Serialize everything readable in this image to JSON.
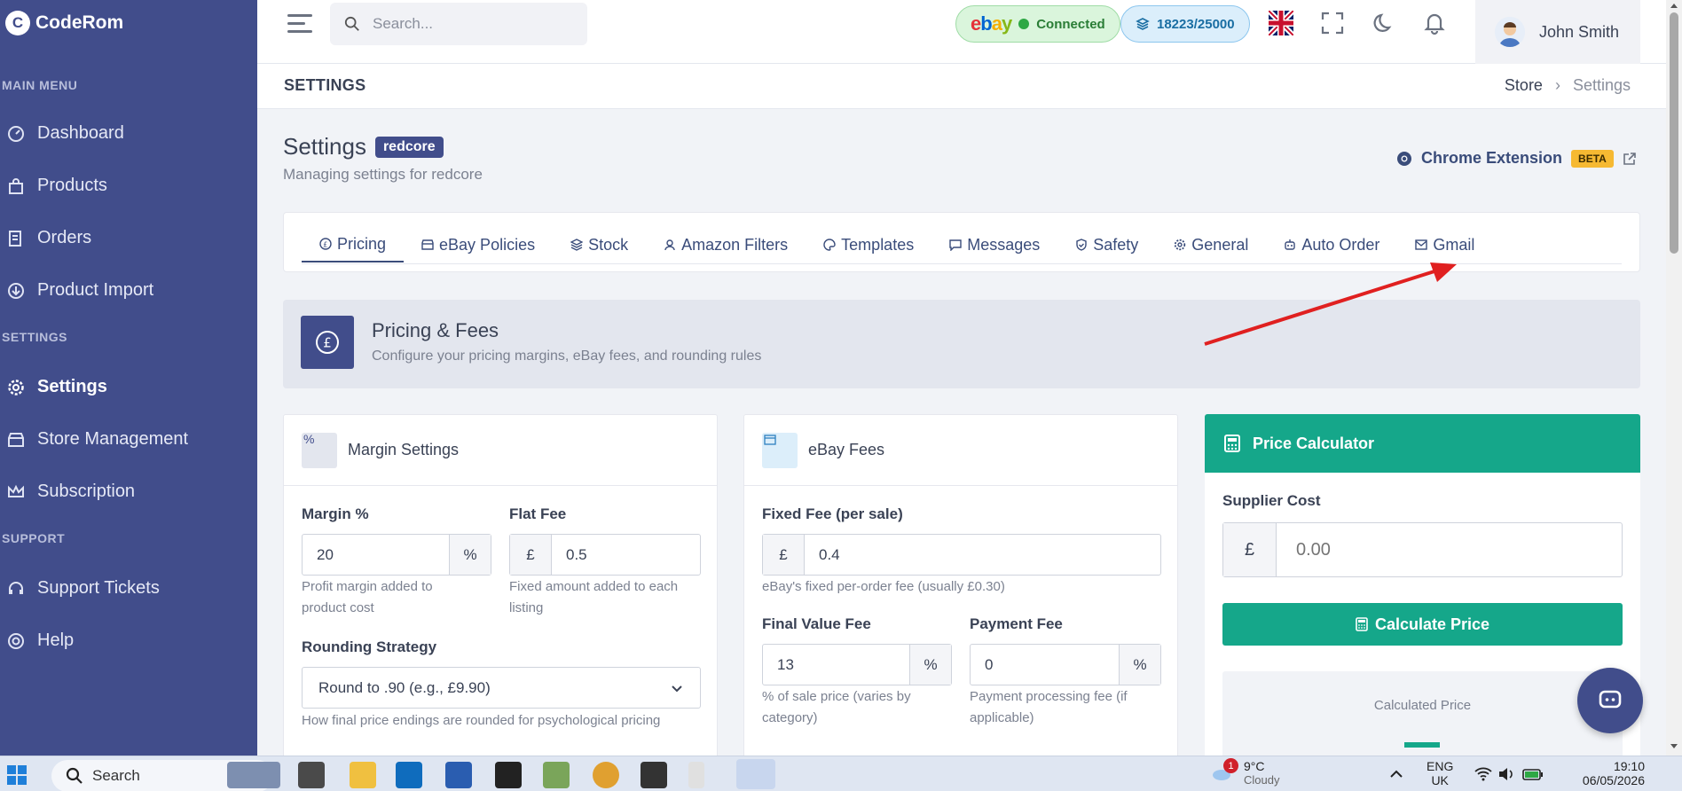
{
  "brand": {
    "name": "CodeRom",
    "logo_letter": "C"
  },
  "sidebar": {
    "sections": [
      {
        "title": "MAIN MENU"
      },
      {
        "title": "SETTINGS"
      },
      {
        "title": "SUPPORT"
      }
    ],
    "items": [
      {
        "label": "Dashboard",
        "icon": "gauge-icon"
      },
      {
        "label": "Products",
        "icon": "bag-icon"
      },
      {
        "label": "Orders",
        "icon": "receipt-icon"
      },
      {
        "label": "Product Import",
        "icon": "download-icon"
      },
      {
        "label": "Settings",
        "icon": "gear-icon",
        "active": true
      },
      {
        "label": "Store Management",
        "icon": "store-icon"
      },
      {
        "label": "Subscription",
        "icon": "crown-icon"
      },
      {
        "label": "Support Tickets",
        "icon": "headset-icon"
      },
      {
        "label": "Help",
        "icon": "lifebuoy-icon"
      }
    ]
  },
  "header": {
    "search_placeholder": "Search...",
    "ebay_status": "Connected",
    "quota": "18223/25000",
    "user_name": "John Smith"
  },
  "crumbbar": {
    "heading": "SETTINGS",
    "breadcrumb": [
      "Store",
      "Settings"
    ]
  },
  "page": {
    "title": "Settings",
    "store_badge": "redcore",
    "subtitle": "Managing settings for redcore",
    "chrome_extension": "Chrome Extension",
    "beta": "BETA"
  },
  "tabs": [
    {
      "label": "Pricing",
      "icon": "pound-icon",
      "active": true
    },
    {
      "label": "eBay Policies",
      "icon": "shop-icon"
    },
    {
      "label": "Stock",
      "icon": "layers-icon"
    },
    {
      "label": "Amazon Filters",
      "icon": "user-icon"
    },
    {
      "label": "Templates",
      "icon": "palette-icon"
    },
    {
      "label": "Messages",
      "icon": "message-icon"
    },
    {
      "label": "Safety",
      "icon": "shield-icon"
    },
    {
      "label": "General",
      "icon": "cog-icon"
    },
    {
      "label": "Auto Order",
      "icon": "robot-icon"
    },
    {
      "label": "Gmail",
      "icon": "mail-icon"
    }
  ],
  "banner": {
    "title": "Pricing & Fees",
    "subtitle": "Configure your pricing margins, eBay fees, and rounding rules",
    "icon_symbol": "£"
  },
  "margin": {
    "title": "Margin Settings",
    "icon_symbol": "%",
    "margin_label": "Margin %",
    "margin_value": "20",
    "margin_unit": "%",
    "margin_help": "Profit margin added to product cost",
    "flat_label": "Flat Fee",
    "flat_prefix": "£",
    "flat_value": "0.5",
    "flat_help": "Fixed amount added to each listing",
    "rounding_label": "Rounding Strategy",
    "rounding_value": "Round to .90 (e.g., £9.90)",
    "rounding_help": "How final price endings are rounded for psychological pricing"
  },
  "fees": {
    "title": "eBay Fees",
    "fixed_label": "Fixed Fee (per sale)",
    "fixed_prefix": "£",
    "fixed_value": "0.4",
    "fixed_help": "eBay's fixed per-order fee (usually £0.30)",
    "fvf_label": "Final Value Fee",
    "fvf_value": "13",
    "fvf_unit": "%",
    "fvf_help": "% of sale price (varies by category)",
    "payment_label": "Payment Fee",
    "payment_value": "0",
    "payment_unit": "%",
    "payment_help": "Payment processing fee (if applicable)"
  },
  "calculator": {
    "title": "Price Calculator",
    "supplier_label": "Supplier Cost",
    "currency": "£",
    "supplier_placeholder": "0.00",
    "button": "Calculate Price",
    "result_label": "Calculated Price"
  },
  "taskbar": {
    "search": "Search",
    "weather_badge": "1",
    "temperature": "9°C",
    "weather": "Cloudy",
    "lang_top": "ENG",
    "lang_bottom": "UK",
    "time": "19:10",
    "date": "06/05/2026"
  },
  "colors": {
    "sidebar": "#414d8b",
    "accent": "#15a78a",
    "beta": "#f6b932",
    "arrow": "#e02020"
  }
}
